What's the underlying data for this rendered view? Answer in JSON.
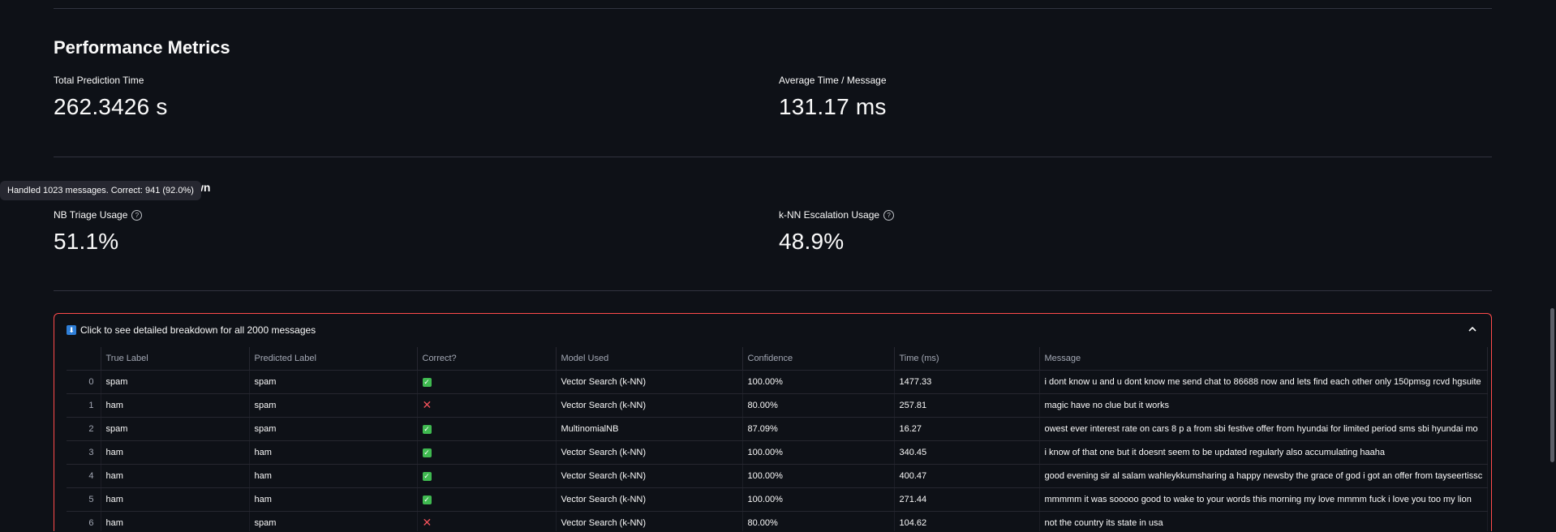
{
  "section": {
    "title": "Performance Metrics"
  },
  "metrics": {
    "total_time": {
      "label": "Total Prediction Time",
      "value": "262.3426 s"
    },
    "avg_time": {
      "label": "Average Time / Message",
      "value": "131.17 ms"
    },
    "nb_usage": {
      "label": "NB Triage Usage",
      "value": "51.1%",
      "help_icon": "question-circle-icon"
    },
    "knn_usage": {
      "label": "k-NN Escalation Usage",
      "value": "48.9%",
      "help_icon": "question-circle-icon"
    }
  },
  "tooltip": {
    "text": "Handled 1023 messages. Correct: 941 (92.0%)"
  },
  "partial_heading": "wn",
  "expander": {
    "label": "Click to see detailed breakdown for all 2000 messages",
    "icon": "down-arrow-icon",
    "chevron_icon": "chevron-up-icon",
    "border_color": "#ff4b4b"
  },
  "table": {
    "columns": [
      "",
      "True Label",
      "Predicted Label",
      "Correct?",
      "Model Used",
      "Confidence",
      "Time (ms)",
      "Message"
    ],
    "rows": [
      {
        "idx": "0",
        "true": "spam",
        "pred": "spam",
        "correct": true,
        "model": "Vector Search (k-NN)",
        "conf": "100.00%",
        "time": "1477.33",
        "msg": "i dont know u and u dont know me send chat to 86688 now and lets find each other only 150pmsg rcvd hgsuite"
      },
      {
        "idx": "1",
        "true": "ham",
        "pred": "spam",
        "correct": false,
        "model": "Vector Search (k-NN)",
        "conf": "80.00%",
        "time": "257.81",
        "msg": "magic have no clue but it works"
      },
      {
        "idx": "2",
        "true": "spam",
        "pred": "spam",
        "correct": true,
        "model": "MultinomialNB",
        "conf": "87.09%",
        "time": "16.27",
        "msg": "owest ever interest rate on cars 8 p a from sbi festive offer from hyundai for limited period sms sbi hyundai mo"
      },
      {
        "idx": "3",
        "true": "ham",
        "pred": "ham",
        "correct": true,
        "model": "Vector Search (k-NN)",
        "conf": "100.00%",
        "time": "340.45",
        "msg": "i know of that one but it doesnt seem to be updated regularly also accumulating haaha"
      },
      {
        "idx": "4",
        "true": "ham",
        "pred": "ham",
        "correct": true,
        "model": "Vector Search (k-NN)",
        "conf": "100.00%",
        "time": "400.47",
        "msg": "good evening sir al salam wahleykkumsharing a happy newsby the grace of god i got an offer from tayseertissc"
      },
      {
        "idx": "5",
        "true": "ham",
        "pred": "ham",
        "correct": true,
        "model": "Vector Search (k-NN)",
        "conf": "100.00%",
        "time": "271.44",
        "msg": "mmmmm it was sooooo good to wake to your words this morning my love mmmm fuck i love you too my lion"
      },
      {
        "idx": "6",
        "true": "ham",
        "pred": "spam",
        "correct": false,
        "model": "Vector Search (k-NN)",
        "conf": "80.00%",
        "time": "104.62",
        "msg": "not the country its state in usa"
      }
    ]
  }
}
